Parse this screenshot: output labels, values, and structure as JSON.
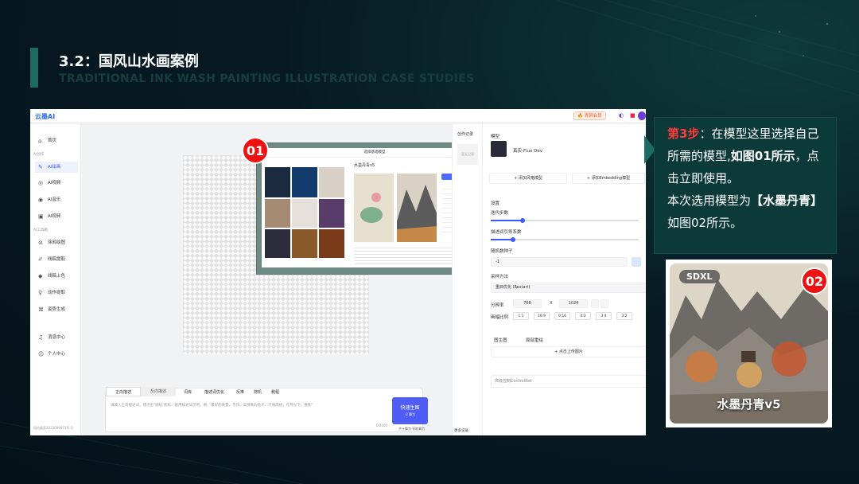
{
  "slide": {
    "title": "3.2：国风山水画案例",
    "subtitle": "TRADITIONAL INK WASH PAINTING ILLUSTRATION CASE STUDIES"
  },
  "app": {
    "logo": "云墨AI",
    "topbar": {
      "vip_label": "🔥 青铜会员",
      "icons": [
        "theme-icon",
        "gift-icon",
        "avatar"
      ]
    },
    "sidebar": {
      "items": [
        {
          "label": "首页",
          "icon": "home-icon"
        },
        {
          "label": "AI绘画",
          "icon": "brush-icon",
          "active": true
        },
        {
          "label": "AI视频",
          "icon": "video-icon"
        },
        {
          "label": "AI音乐",
          "icon": "music-icon"
        },
        {
          "label": "AI视频",
          "icon": "film-icon"
        },
        {
          "label": "涂鸦绘图",
          "icon": "doodle-icon"
        },
        {
          "label": "线稿提取",
          "icon": "lineart-icon"
        },
        {
          "label": "线稿上色",
          "icon": "bucket-icon"
        },
        {
          "label": "动作提取",
          "icon": "pose-icon"
        },
        {
          "label": "姿势生成",
          "icon": "skeleton-icon"
        },
        {
          "label": "消息中心",
          "icon": "bell-icon"
        },
        {
          "label": "个人中心",
          "icon": "user-icon"
        }
      ],
      "groups": [
        "AI创作",
        "AI工具箱"
      ],
      "footer": "网站备案2023089871号-3"
    },
    "inner_dialog": {
      "title": "选择基础模型",
      "model_name": "水墨丹青v5",
      "badge": "01",
      "action": "立即使用"
    },
    "prompt": {
      "tabs": [
        "正向描述",
        "反向描述"
      ],
      "tools": [
        "词库",
        "描述词优化",
        "反推",
        "随机",
        "教程"
      ],
      "placeholder": "请输入正向描述词，或点击\"随机\"图标、套用描述词示例。例: \"最好的质量，杰作，高保真的兔子，卡通风格，在月光下，逼真\"",
      "counter": "0/2000",
      "generate_label": "快速生图",
      "generate_cost": "-2 算力",
      "footer_link": "共计算力 获取算力"
    },
    "right": {
      "history_tab": "创作记录",
      "history_item": "暂无记录",
      "model_label": "模型",
      "model_value": "真实-Flux Dev",
      "add_style": "添加风格模型",
      "add_embedding": "添加Embedding模型",
      "settings": "设置",
      "steps_label": "迭代步数",
      "cfg_label": "描述词引导系数",
      "seed_label": "随机数种子",
      "seed_value": "-1",
      "sampler_label": "采样方法",
      "sampler_value": "重启优化 (Restart)",
      "resolution_label": "分辨率",
      "width": "768",
      "x_label": "X",
      "height": "1024",
      "ratio_label": "画幅比例",
      "ratios": [
        "1:1",
        "16:9",
        "9:16",
        "4:3",
        "3:4",
        "3:2"
      ],
      "img2img": "图生图",
      "local_redraw": "局部重绘",
      "upload": "+ 点击上传图片",
      "controlnet": "高级控制ControlNet",
      "history_footer": "更多记录"
    }
  },
  "info": {
    "step_red": "第3步",
    "line1": "：在模型这里选择自己所需的模型,",
    "bold1": "如图01所示",
    "line2": "，点击立即使用。",
    "line3": "本次选用模型为",
    "bold2": "【水墨丹青】",
    "line4": "如图02所示。"
  },
  "model_card": {
    "tag": "SDXL",
    "name": "水墨丹青v5",
    "badge": "02"
  }
}
